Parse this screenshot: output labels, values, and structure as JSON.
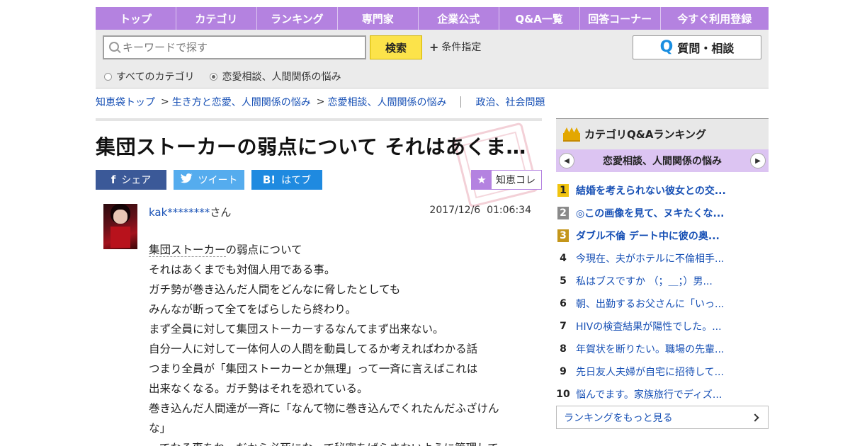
{
  "nav": [
    "トップ",
    "カテゴリ",
    "ランキング",
    "専門家",
    "企業公式",
    "Q&A一覧",
    "回答コーナー",
    "今すぐ利用登録"
  ],
  "search": {
    "placeholder": "キーワードで探す",
    "button": "検索",
    "conditions": "条件指定",
    "ask_button": "質問・相談",
    "ask_icon": "Q",
    "radio_all": "すべてのカテゴリ",
    "radio_current": "恋愛相談、人間関係の悩み",
    "selected": "恋愛相談、人間関係の悩み"
  },
  "breadcrumb": {
    "home": "知恵袋トップ",
    "level1": "生き方と恋愛、人間関係の悩み",
    "level2": "恋愛相談、人間関係の悩み",
    "related": "政治、社会問題",
    "separator": ">"
  },
  "question": {
    "title": "集団ストーカーの弱点について それはあくま…",
    "user": "kak********",
    "user_suffix": "さん",
    "date": "2017/12/6",
    "time": "01:06:34",
    "body": [
      "の弱点について",
      "それはあくまでも対個人用である事。",
      "ガチ勢が巻き込んだ人間をどんなに脅したとしても",
      "みんなが断って全てをばらしたら終わり。",
      "まず全員に対して集団ストーカーするなんてまず出来ない。",
      "自分一人に対して一体何人の人間を動員してるか考えればわかる話",
      "つまり全員が「集団ストーカーとか無理」って一斉に言えばこれは",
      "出来なくなる。ガチ勢はそれを恐れている。",
      "巻き込んだ人間達が一斉に「なんて物に巻き込んでくれたんだふざけん",
      "な」",
      "ってなる事をね。だから必死になって秘密をばらさないように管理して"
    ],
    "keyword": "集団ストーカー"
  },
  "share": {
    "facebook": "シェア",
    "twitter": "ツイート",
    "hatena": "はてブ",
    "facebook_icon": "f",
    "hatena_icon": "B!",
    "collect": "知恵コレ"
  },
  "sidebar": {
    "title": "カテゴリQ&Aランキング",
    "category": "恋愛相談、人間関係の悩み",
    "ranking": [
      {
        "rank": "1",
        "text": "結婚を考えられない彼女との交..."
      },
      {
        "rank": "2",
        "text": "◎この画像を見て、ヌキたくな..."
      },
      {
        "rank": "3",
        "text": "ダブル不倫 デート中に彼の奥..."
      },
      {
        "rank": "4",
        "text": "今現在、夫がホテルに不倫相手..."
      },
      {
        "rank": "5",
        "text": "私はブスですか （；＿；）男..."
      },
      {
        "rank": "6",
        "text": "朝、出勤するお父さんに「いっ..."
      },
      {
        "rank": "7",
        "text": "HIVの検査結果が陽性でした。..."
      },
      {
        "rank": "8",
        "text": "年賀状を断りたい。職場の先輩..."
      },
      {
        "rank": "9",
        "text": "先日友人夫婦が自宅に招待して..."
      },
      {
        "rank": "10",
        "text": "悩んでます。家族旅行でディズ..."
      }
    ],
    "more": "ランキングをもっと見る"
  },
  "colors": {
    "nav": "#b482e0",
    "search_button": "#fce34a",
    "link": "#1750b5",
    "category_bar": "#dcc4f2"
  }
}
